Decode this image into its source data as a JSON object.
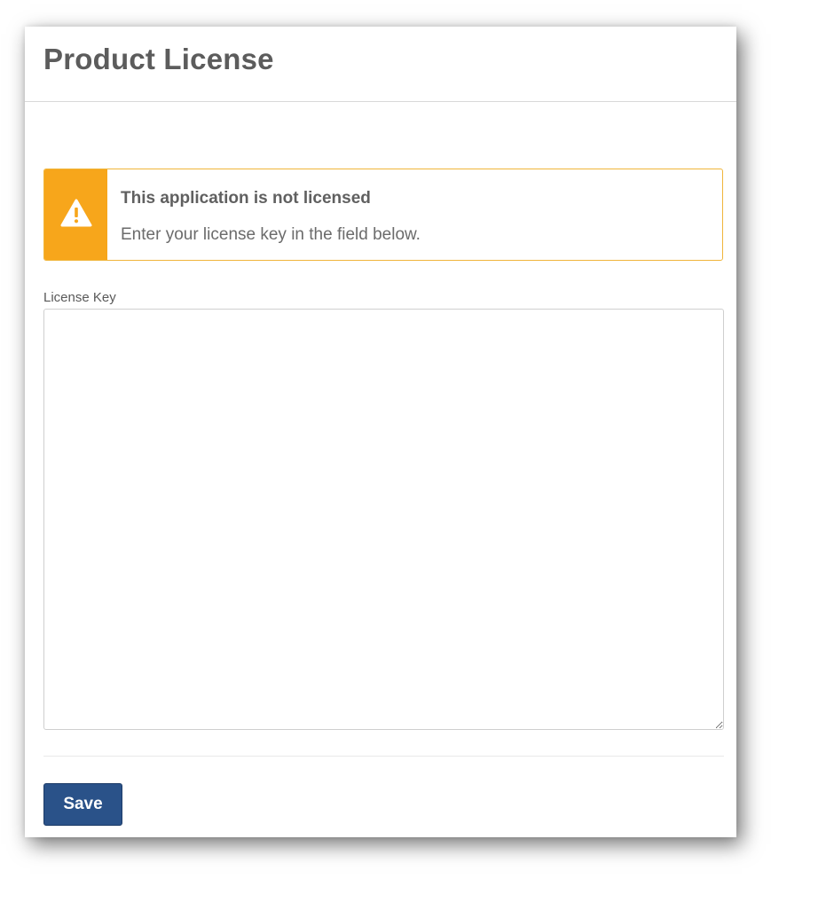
{
  "page": {
    "title": "Product License"
  },
  "alert": {
    "icon": "warning-triangle-icon",
    "title": "This application is not licensed",
    "message": "Enter your license key in the field below.",
    "accent_color": "#f7a61b"
  },
  "license_field": {
    "label": "License Key",
    "value": "",
    "placeholder": ""
  },
  "actions": {
    "save_label": "Save",
    "save_color": "#2a5289"
  }
}
